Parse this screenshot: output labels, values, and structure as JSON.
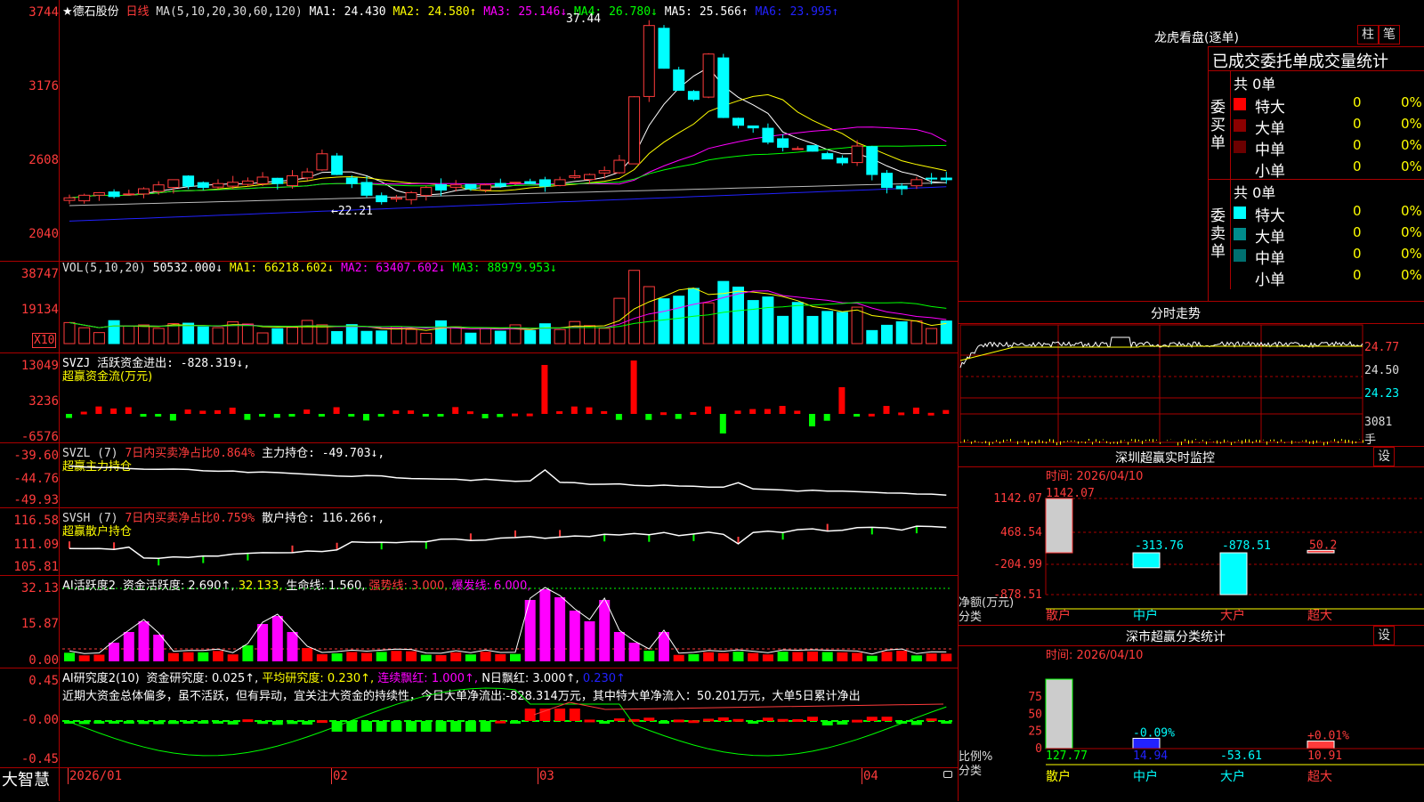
{
  "main": {
    "stock_name": "★德石股份",
    "period": "日线",
    "ma_params": "MA(5,10,20,30,60,120)",
    "ma": [
      {
        "label": "MA1: 24.430",
        "color": "#ffffff"
      },
      {
        "label": "MA2: 24.580↑",
        "color": "#ffff00"
      },
      {
        "label": "MA3: 25.146↓",
        "color": "#ff00ff"
      },
      {
        "label": "MA4: 26.780↓",
        "color": "#00ff00"
      },
      {
        "label": "MA5: 25.566↑",
        "color": "#ffffff"
      },
      {
        "label": "MA6: 23.995↑",
        "color": "#2222ff"
      }
    ],
    "y_ticks": [
      "3744",
      "3176",
      "2608",
      "2040"
    ],
    "max_mark": "37.44",
    "min_mark": "←22.21"
  },
  "vol": {
    "title": "VOL(5,10,20)",
    "value": "50532.000↓",
    "ma": [
      {
        "label": "MA1: 66218.602↓",
        "color": "#ffff00"
      },
      {
        "label": "MA2: 63407.602↓",
        "color": "#ff00ff"
      },
      {
        "label": "MA3: 88979.953↓",
        "color": "#00ff00"
      }
    ],
    "y_ticks": [
      "38747",
      "19134"
    ],
    "unit": "X10"
  },
  "svzj": {
    "title": "SVZJ  活跃资金进出: -828.319↓,",
    "subtitle": "超赢资金流(万元)",
    "y_ticks": [
      "13049",
      "3236",
      "-6576"
    ]
  },
  "svzl": {
    "title_a": "SVZL (7)",
    "title_b": "7日内买卖净占比0.864%",
    "title_c": "主力持仓: -49.703↓,",
    "subtitle": "超赢主力持仓",
    "y_ticks": [
      "-39.60",
      "-44.76",
      "-49.93"
    ]
  },
  "svsh": {
    "title_a": "SVSH (7)",
    "title_b": "7日内买卖净占比0.759%",
    "title_c": "散户持仓: 116.266↑,",
    "subtitle": "超赢散户持仓",
    "y_ticks": [
      "116.58",
      "111.09",
      "105.81"
    ]
  },
  "ai1": {
    "title": "AI活跃度2",
    "items": [
      {
        "label": "资金活跃度: 2.690↑,",
        "color": "#ffffff"
      },
      {
        "label": "32.133,",
        "color": "#ffff00"
      },
      {
        "label": "生命线: 1.560,",
        "color": "#ffffff"
      },
      {
        "label": "强势线: 3.000,",
        "color": "#ff3b3b"
      },
      {
        "label": "爆发线: 6.000,",
        "color": "#ff00ff"
      }
    ],
    "y_ticks": [
      "32.13",
      "15.87",
      "0.00"
    ]
  },
  "ai2": {
    "title": "AI研究度2(10)",
    "items": [
      {
        "label": "资金研究度: 0.025↑,",
        "color": "#ffffff"
      },
      {
        "label": "平均研究度: 0.230↑,",
        "color": "#ffff00"
      },
      {
        "label": "连续飘红: 1.000↑,",
        "color": "#ff00ff"
      },
      {
        "label": "N日飘红: 3.000↑,",
        "color": "#ffffff"
      },
      {
        "label": "0.230↑",
        "color": "#2222ff"
      }
    ],
    "comment": "近期大资金总体偏多，虽不活跃，但有异动，宜关注大资金的持续性，今日大单净流出:-828.314万元，其中特大单净流入：50.201万元，大单5日累计净出",
    "y_ticks": [
      "0.45",
      "-0.00",
      "-0.45"
    ]
  },
  "bottom": {
    "brand": "大智慧",
    "dates": [
      "2026/01",
      "02",
      "03",
      "04"
    ]
  },
  "lhb": {
    "title": "龙虎看盘(逐单)",
    "btn1": "柱",
    "btn2": "笔",
    "subtitle": "已成交委托单成交量统计",
    "buy_label": "委买单",
    "sell_label": "委卖单",
    "buy_total": "共 0单",
    "sell_total": "共 0单",
    "buy_rows": [
      {
        "name": "特大",
        "count": "0",
        "pct": "0%",
        "color": "#ff0000"
      },
      {
        "name": "大单",
        "count": "0",
        "pct": "0%",
        "color": "#8b0000"
      },
      {
        "name": "中单",
        "count": "0",
        "pct": "0%",
        "color": "#6b0000"
      },
      {
        "name": "小单",
        "count": "0",
        "pct": "0%",
        "color": ""
      }
    ],
    "sell_rows": [
      {
        "name": "特大",
        "count": "0",
        "pct": "0%",
        "color": "#00ffff"
      },
      {
        "name": "大单",
        "count": "0",
        "pct": "0%",
        "color": "#008b8b"
      },
      {
        "name": "中单",
        "count": "0",
        "pct": "0%",
        "color": "#007070"
      },
      {
        "name": "小单",
        "count": "0",
        "pct": "0%",
        "color": ""
      }
    ]
  },
  "fs": {
    "title": "分时走势",
    "y_ticks": [
      "24.77",
      "24.50",
      "24.23"
    ],
    "vol_label": "3081",
    "vol_unit": "手"
  },
  "sz_monitor": {
    "title": "深圳超赢实时监控",
    "setting": "设",
    "time": "时间: 2026/04/10",
    "y_ticks": [
      "1142.07",
      "468.54",
      "-204.99",
      "-878.51"
    ],
    "axis_label": "净额(万元)",
    "cat_label": "分类",
    "chart_data": {
      "type": "bar",
      "categories": [
        "散户",
        "中户",
        "大户",
        "超大"
      ],
      "values": [
        1142.07,
        -313.76,
        -878.51,
        50.2
      ],
      "labels": [
        "1142.07",
        "-313.76",
        "-878.51",
        "50.2"
      ],
      "ylim": [
        -878.51,
        1142.07
      ]
    }
  },
  "sz_class": {
    "title": "深市超赢分类统计",
    "setting": "设",
    "time": "时间: 2026/04/10",
    "y_ticks": [
      "75",
      "50",
      "25",
      "0"
    ],
    "axis_label": "比例%",
    "cat_label": "分类",
    "chart_data": {
      "type": "bar",
      "categories": [
        "散户",
        "中户",
        "大户",
        "超大"
      ],
      "values": [
        127.77,
        14.94,
        -53.61,
        10.91
      ],
      "bar_labels": [
        "",
        "-0.09%",
        "",
        "+0.01%"
      ],
      "value_labels": [
        "127.77",
        "14.94",
        "-53.61",
        "10.91"
      ],
      "ylim": [
        0,
        75
      ]
    }
  }
}
